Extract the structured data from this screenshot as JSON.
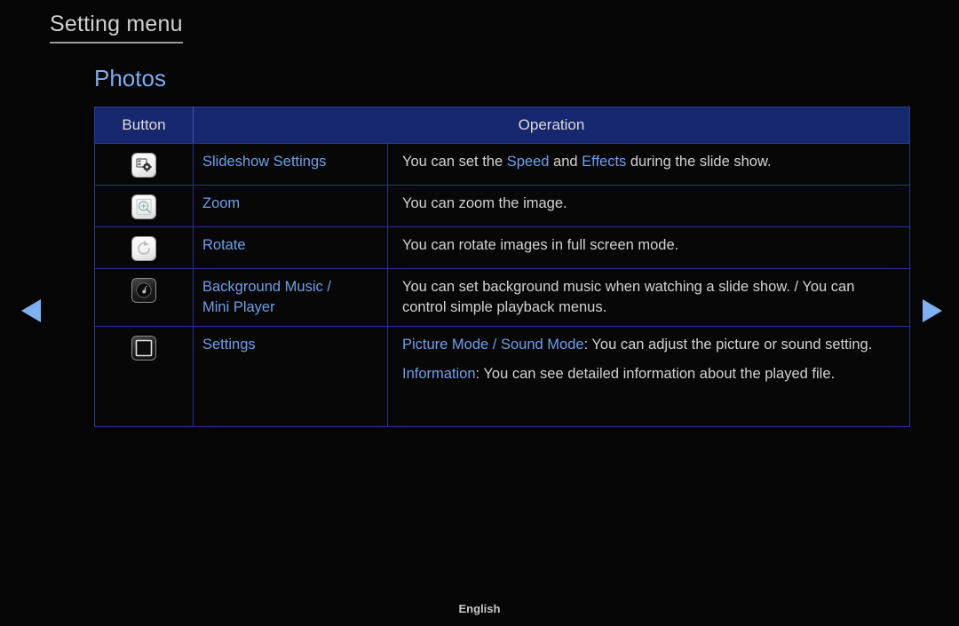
{
  "header": {
    "title": "Setting menu",
    "section": "Photos"
  },
  "table": {
    "columns": [
      "Button",
      "Operation"
    ],
    "rows": [
      {
        "icon": "slideshow-settings-icon",
        "item": "Slideshow Settings",
        "operation_parts": [
          [
            {
              "t": "You can set the ",
              "hl": false
            },
            {
              "t": "Speed",
              "hl": true
            },
            {
              "t": " and ",
              "hl": false
            },
            {
              "t": "Effects",
              "hl": true
            },
            {
              "t": " during the slide show.",
              "hl": false
            }
          ]
        ]
      },
      {
        "icon": "zoom-icon",
        "item": "Zoom",
        "operation_parts": [
          [
            {
              "t": "You can zoom the image.",
              "hl": false
            }
          ]
        ]
      },
      {
        "icon": "rotate-icon",
        "item": "Rotate",
        "operation_parts": [
          [
            {
              "t": "You can rotate images in full screen mode.",
              "hl": false
            }
          ]
        ]
      },
      {
        "icon": "background-music-icon",
        "item": "Background Music /\nMini Player",
        "operation_parts": [
          [
            {
              "t": "You can set background music when watching a slide show. / You can control simple playback menus.",
              "hl": false
            }
          ]
        ]
      },
      {
        "icon": "settings-icon",
        "item": "Settings",
        "operation_parts": [
          [
            {
              "t": "Picture Mode",
              "hl": true
            },
            {
              "t": " / ",
              "hl": true
            },
            {
              "t": "Sound Mode",
              "hl": true
            },
            {
              "t": ": You can adjust the picture or sound setting.",
              "hl": false
            }
          ],
          [
            {
              "t": "Information",
              "hl": true
            },
            {
              "t": ": You can see detailed information about the played file.",
              "hl": false
            }
          ]
        ]
      }
    ]
  },
  "nav": {
    "prev": "previous-page-arrow",
    "next": "next-page-arrow"
  },
  "footer": {
    "language": "English"
  },
  "colors": {
    "background": "#050505",
    "header_blue": "#16276d",
    "accent_blue": "#6f9fe8",
    "arrow_blue": "#7fb0f2",
    "body_text": "#d2d2d2",
    "border_blue": "#26348f"
  }
}
